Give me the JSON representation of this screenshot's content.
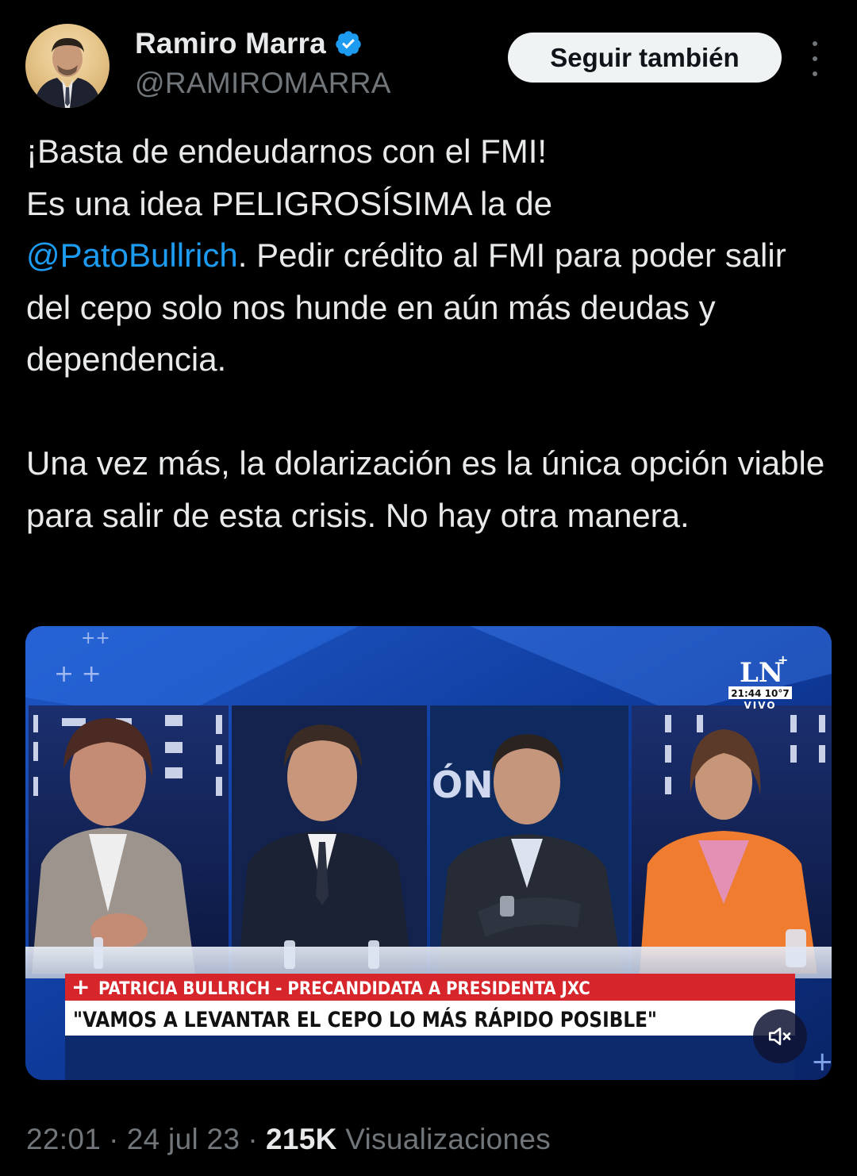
{
  "author": {
    "display_name": "Ramiro Marra",
    "handle": "@RAMIROMARRA",
    "verified": true,
    "verified_color": "#1d9bf0"
  },
  "header": {
    "follow_label": "Seguir también",
    "more_icon": "more-vertical-icon"
  },
  "tweet": {
    "line1": "¡Basta de endeudarnos con el FMI!",
    "line2": "Es una idea PELIGROSÍSIMA la de",
    "mention": "@PatoBullrich",
    "after_mention": ". Pedir crédito al FMI para poder salir del cepo solo nos hunde en aún más deudas y dependencia.",
    "paragraph2": "Una vez más, la dolarización es la única opción viable para salir de esta crisis. No hay otra manera."
  },
  "media": {
    "channel_logo": "LN",
    "channel_logo_plus": "+",
    "clock": "21:44 10°7",
    "live_label": "VIVO",
    "backdrop_text": "ÓN",
    "lower_third_name": "PATRICIA BULLRICH - PRECANDIDATA A PRESIDENTA JXC",
    "lower_third_plus": "+",
    "lower_third_quote": "\"VAMOS A LEVANTAR EL CEPO LO MÁS RÁPIDO POSIBLE\"",
    "mute_icon": "muted-speaker-icon"
  },
  "meta": {
    "time": "22:01",
    "date": "24 jul 23",
    "views_count": "215K",
    "views_label": "Visualizaciones",
    "separator": "·"
  },
  "colors": {
    "background": "#000000",
    "text": "#e7e9ea",
    "secondary": "#71767b",
    "link": "#1d9bf0",
    "button_bg": "#eff3f4",
    "lower_third_red": "#d6252b"
  }
}
